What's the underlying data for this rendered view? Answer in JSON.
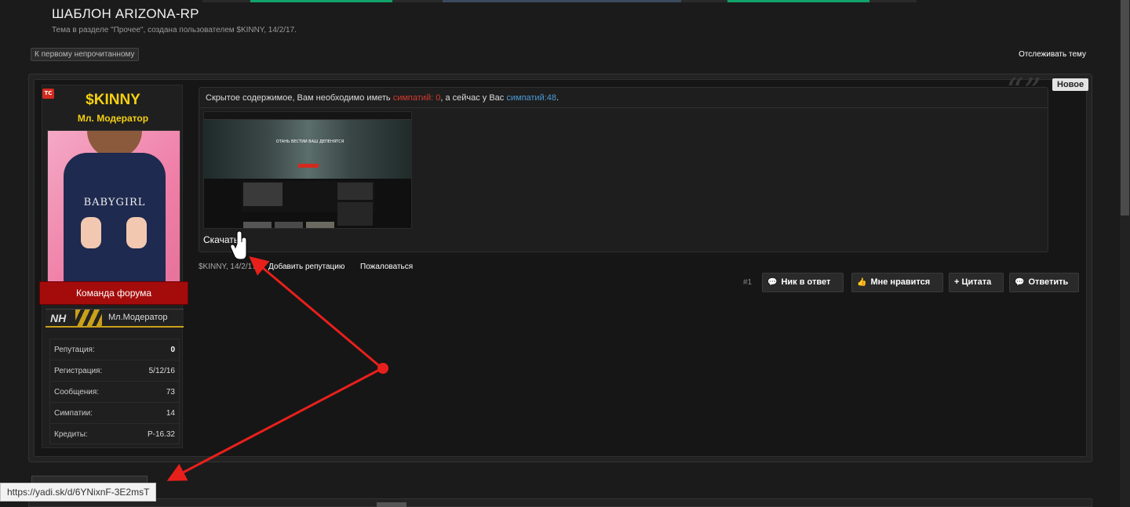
{
  "thread": {
    "title": "ШАБЛОН ARIZONA-RP",
    "subtitle": "Тема в разделе \"Прочее\", создана пользователем $KINNY, 14/2/17.",
    "first_unread": "К первому непрочитанному",
    "watch": "Отслеживать тему",
    "new_badge": "Новое"
  },
  "user": {
    "tc_badge": "ТС",
    "name": "$KINNY",
    "title": "Мл. Модератор",
    "avatar_text": "BABYGIRL",
    "team_banner": "Команда форума",
    "rank_logo": "NH",
    "rank_label": "Мл.Модератор",
    "stats": [
      {
        "label": "Репутация:",
        "value": "0"
      },
      {
        "label": "Регистрация:",
        "value": "5/12/16"
      },
      {
        "label": "Сообщения:",
        "value": "73"
      },
      {
        "label": "Симпатии:",
        "value": "14"
      },
      {
        "label": "Кредиты:",
        "value": "Р-16.32"
      }
    ]
  },
  "message": {
    "hidden_prefix": "Скрытое содержимое, Вам необходимо иметь ",
    "likes_needed": "симпатий: 0",
    "hidden_middle": ", а сейчас у Вас ",
    "likes_current": "симпатий:48",
    "hidden_suffix": ".",
    "quote_glyph": "“”",
    "screenshot_title": "ОТАНЬ ВЕСТИИ ВАШ ДЕПЕНЯТСЯ",
    "download": "Скачать"
  },
  "meta": {
    "author_date": "$KINNY, 14/2/17",
    "add_rep": "Добавить репутацию",
    "report": "Пожаловаться"
  },
  "actions": {
    "post_num": "#1",
    "nick_reply": "Ник в ответ",
    "like": "Мне нравится",
    "quote": "+ Цитата",
    "reply": "Ответить"
  },
  "status_bar": {
    "url": "https://yadi.sk/d/6YNixnF-3E2msT"
  },
  "colors": {
    "username": "#f5d011",
    "accent_red": "#d33a2f",
    "accent_blue": "#4a9ad6",
    "topbar_green": "#11a36b",
    "annotation_red": "#e8201c"
  },
  "icons": {
    "chat": "chat-bubble-icon",
    "like": "thumbs-up-icon",
    "cursor": "hand-pointer-icon"
  }
}
